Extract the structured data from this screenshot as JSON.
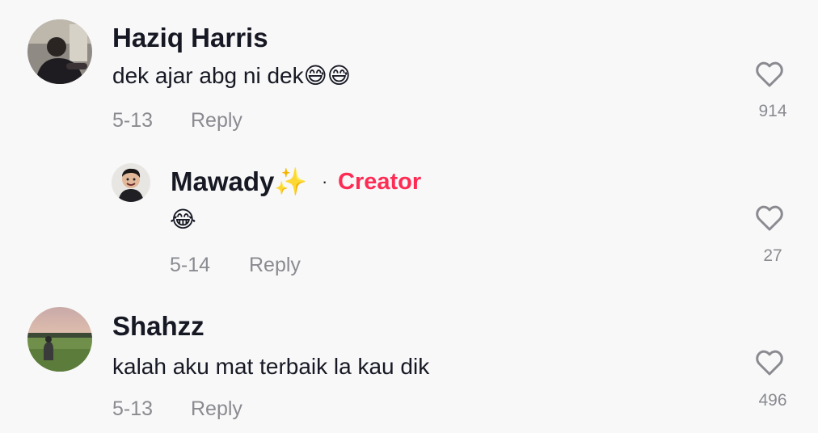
{
  "comments": [
    {
      "author": "Haziq Harris",
      "text": "dek ajar abg ni dek",
      "emoji": "😅😅",
      "date": "5-13",
      "reply_label": "Reply",
      "likes": "914",
      "avatar_icon": "user-photo-avatar"
    },
    {
      "author": "Mawady",
      "author_emoji": "✨",
      "separator": "·",
      "badge": "Creator",
      "text": "😂",
      "date": "5-14",
      "reply_label": "Reply",
      "likes": "27",
      "avatar_icon": "user-photo-avatar"
    },
    {
      "author": "Shahzz",
      "text": "kalah aku mat terbaik la kau dik",
      "date": "5-13",
      "reply_label": "Reply",
      "likes": "496",
      "avatar_icon": "landscape-photo-avatar"
    }
  ],
  "colors": {
    "creator_badge": "#fe2c55",
    "meta_text": "#8a8b91",
    "primary_text": "#161823",
    "background": "#f8f8f8"
  },
  "icons": {
    "like": "heart-outline-icon"
  }
}
